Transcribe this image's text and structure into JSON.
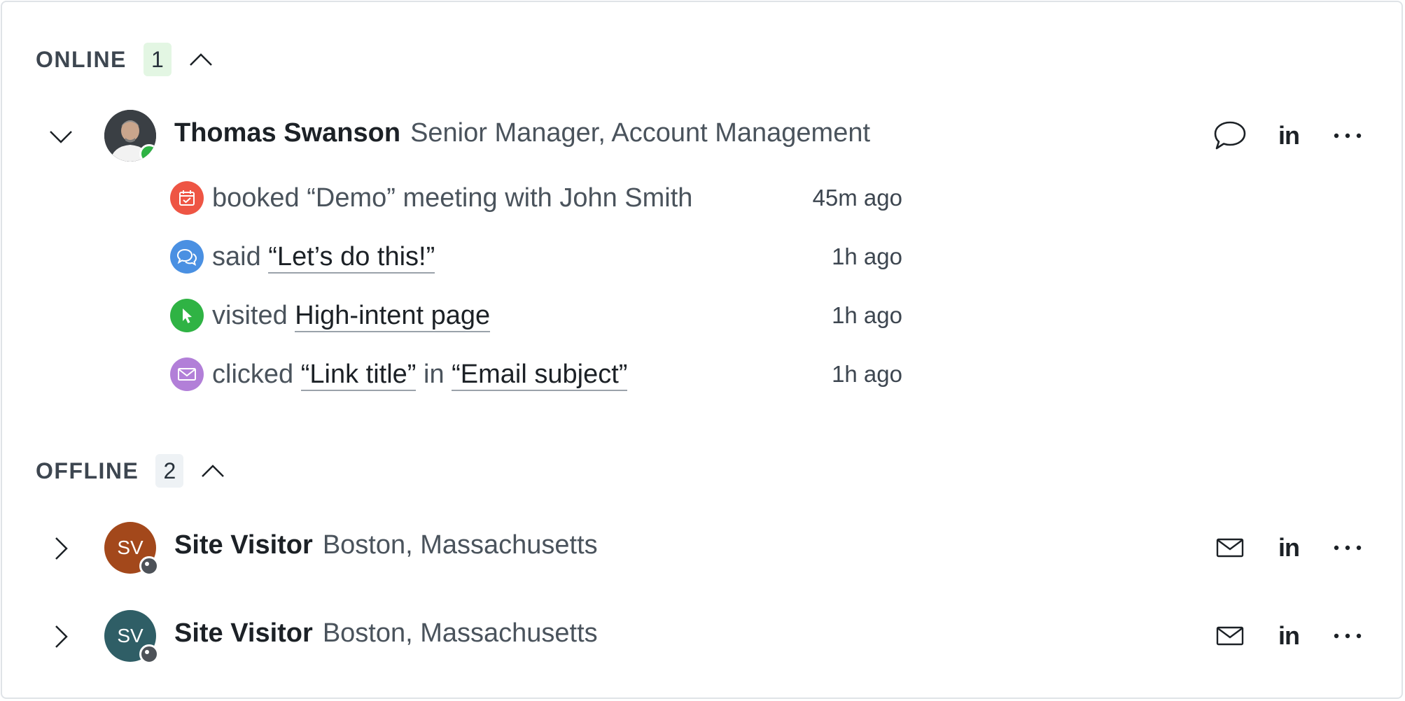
{
  "online": {
    "title": "ONLINE",
    "count": "1",
    "person": {
      "name": "Thomas Swanson",
      "title": "Senior Manager, Account Management",
      "activities": [
        {
          "icon": "calendar-check-icon",
          "color": "#ee5544",
          "parts": [
            {
              "text": "booked “Demo” meeting with John Smith",
              "link": false
            }
          ],
          "time": "45m ago"
        },
        {
          "icon": "chat-bubbles-icon",
          "color": "#4a90e2",
          "parts": [
            {
              "text": "said",
              "link": false
            },
            {
              "text": "“Let’s do this!”",
              "link": true
            }
          ],
          "time": "1h ago"
        },
        {
          "icon": "cursor-icon",
          "color": "#2fb344",
          "parts": [
            {
              "text": "visited",
              "link": false
            },
            {
              "text": "High-intent page",
              "link": true
            }
          ],
          "time": "1h ago"
        },
        {
          "icon": "envelope-icon",
          "color": "#b27fd8",
          "parts": [
            {
              "text": "clicked",
              "link": false
            },
            {
              "text": "“Link title”",
              "link": true
            },
            {
              "text": "in",
              "link": false
            },
            {
              "text": "“Email subject”",
              "link": true
            }
          ],
          "time": "1h ago"
        }
      ]
    }
  },
  "offline": {
    "title": "OFFLINE",
    "count": "2",
    "visitors": [
      {
        "initials": "SV",
        "name": "Site Visitor",
        "location": "Boston, Massachusetts",
        "color": "#a3481b"
      },
      {
        "initials": "SV",
        "name": "Site Visitor",
        "location": "Boston, Massachusetts",
        "color": "#2f5e66"
      }
    ]
  },
  "colors": {
    "online_badge": "#e3f6e3",
    "offline_badge": "#eef2f5",
    "online_dot": "#2fb344",
    "offline_dot": "#4d5258"
  }
}
